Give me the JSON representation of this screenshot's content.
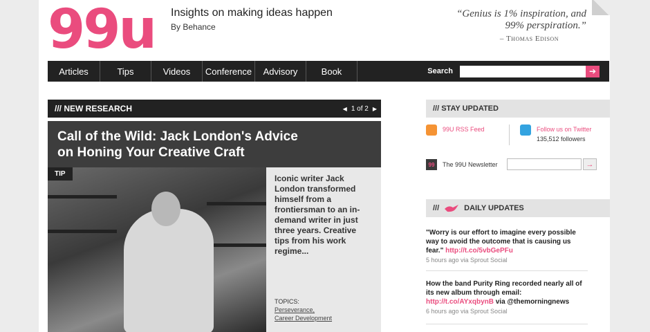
{
  "header": {
    "logo": "99u",
    "tagline": "Insights on making ideas happen",
    "byline": "By Behance",
    "quote": "“Genius is 1% inspiration, and 99% perspiration.”",
    "quote_author": "– Thomas Edison"
  },
  "nav": {
    "items": [
      "Articles",
      "Tips",
      "Videos",
      "Conference",
      "Advisory",
      "Book"
    ],
    "search_label": "Search",
    "search_go": "➔"
  },
  "feature": {
    "section_title": "/// NEW RESEARCH",
    "pager": "1 of 2",
    "title_line1": "Call of the Wild: Jack London's Advice",
    "title_line2": "on Honing Your Creative Craft",
    "badge": "TIP",
    "excerpt": "Iconic writer Jack London transformed himself from a frontiersman to an in-demand writer in just three years. Creative tips from his work regime...",
    "topics_label": "TOPICS:",
    "topics": [
      "Perseverance,",
      "Career Development"
    ]
  },
  "sidebar": {
    "stay_updated": "/// STAY UPDATED",
    "rss_label": "99U RSS Feed",
    "twitter_label": "Follow us on Twitter",
    "twitter_count": "135,512 followers",
    "newsletter_icon": "99",
    "newsletter_label": "The 99U Newsletter",
    "newsletter_go": "→",
    "daily_prefix": "///",
    "daily_title": "DAILY UPDATES",
    "updates": [
      {
        "text": "\"Worry is our effort to imagine every possible way to avoid the outcome that is causing us fear.\"",
        "link": "http://t.co/5vbGePFu",
        "meta": "5 hours ago via Sprout Social"
      },
      {
        "text": "How the band Purity Ring recorded nearly all of its new album through email:",
        "link": "http://t.co/AYxqbynB",
        "suffix": "via @themorningnews",
        "meta": "6 hours ago via Sprout Social"
      }
    ]
  },
  "colors": {
    "brand": "#ea4c7e",
    "nav_bg": "#222222",
    "rss": "#f59334",
    "twitter": "#33a3e0"
  }
}
